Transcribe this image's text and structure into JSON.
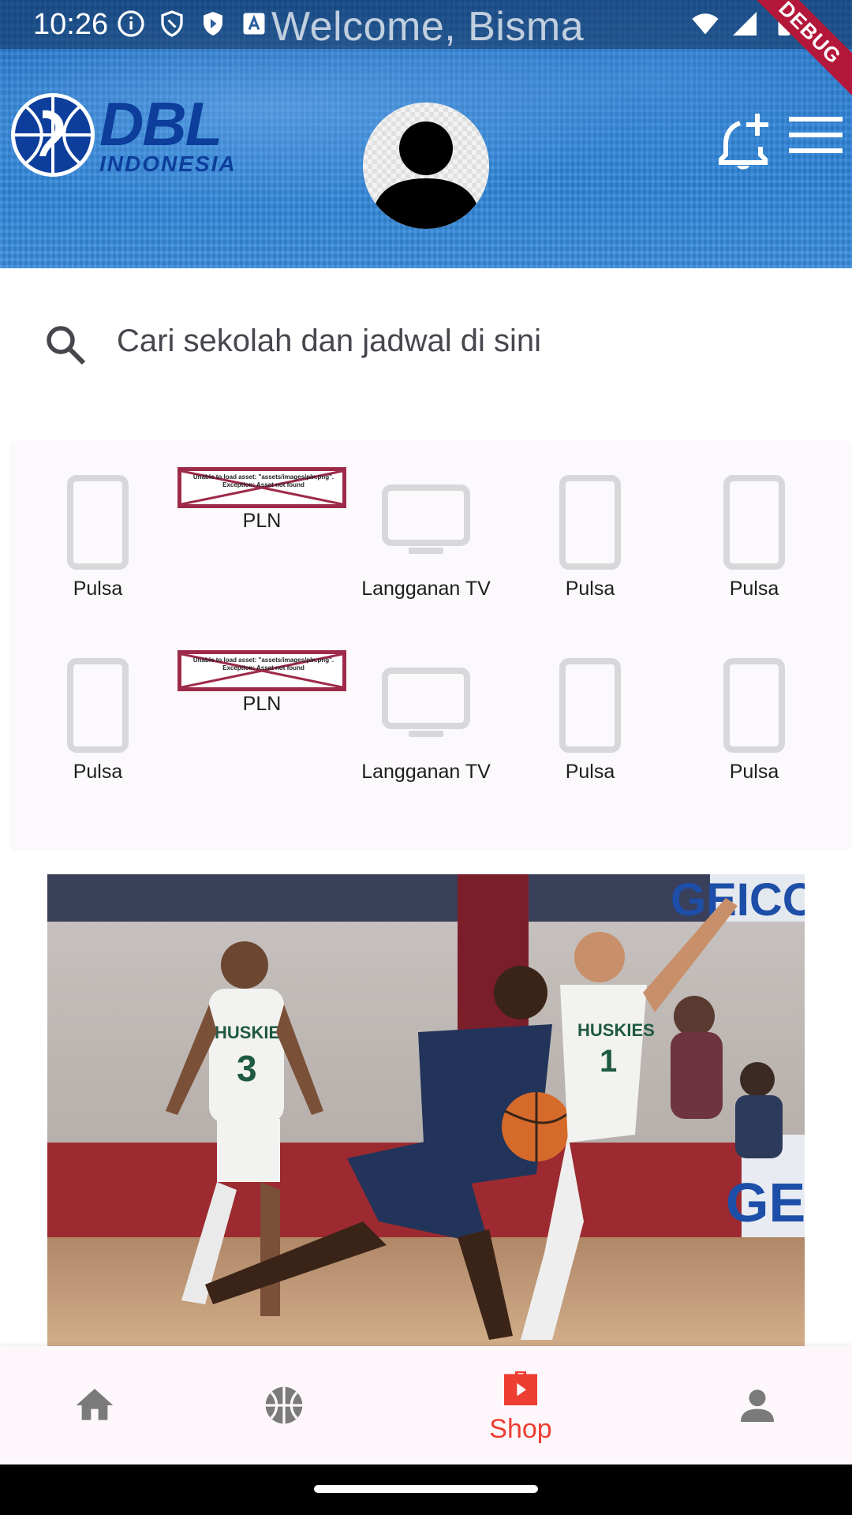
{
  "status_bar": {
    "time": "10:26",
    "welcome_text": "Welcome, Bisma",
    "debug_label": "DEBUG",
    "left_icons": [
      "info-icon",
      "shield-icon",
      "play-store-icon",
      "font-a-icon"
    ],
    "right_icons": [
      "wifi-icon",
      "signal-icon",
      "battery-icon"
    ]
  },
  "header": {
    "logo": {
      "main": "DBL",
      "sub": "INDONESIA"
    },
    "icons": [
      "notification-add-icon",
      "menu-icon"
    ],
    "brand_color": "#1d6fc8"
  },
  "search": {
    "placeholder": "Cari sekolah dan jadwal di sini",
    "icon": "search-icon"
  },
  "menu_grid": {
    "error_message": "Unable to load asset: \"assets/images/pln.png\". Exception: Asset not found",
    "rows": [
      [
        {
          "label": "Pulsa",
          "icon": "phone-icon"
        },
        {
          "label": "PLN",
          "icon": "broken-image"
        },
        {
          "label": "Langganan TV",
          "icon": "tv-icon"
        },
        {
          "label": "Pulsa",
          "icon": "phone-icon"
        },
        {
          "label": "Pulsa",
          "icon": "phone-icon"
        }
      ],
      [
        {
          "label": "Pulsa",
          "icon": "phone-icon"
        },
        {
          "label": "PLN",
          "icon": "broken-image"
        },
        {
          "label": "Langganan TV",
          "icon": "tv-icon"
        },
        {
          "label": "Pulsa",
          "icon": "phone-icon"
        },
        {
          "label": "Pulsa",
          "icon": "phone-icon"
        }
      ]
    ]
  },
  "banner": {
    "jersey_text": "HUSKIES",
    "jersey_numbers": [
      "3",
      "1"
    ],
    "sponsor_text": "GEICO"
  },
  "bottom_nav": {
    "items": [
      {
        "icon": "home-icon",
        "label": ""
      },
      {
        "icon": "basketball-icon",
        "label": ""
      },
      {
        "icon": "shop-bag-icon",
        "label": "Shop",
        "active": true
      },
      {
        "icon": "person-icon",
        "label": ""
      }
    ],
    "active_color": "#ee3d32",
    "inactive_color": "#7a7a7a"
  }
}
